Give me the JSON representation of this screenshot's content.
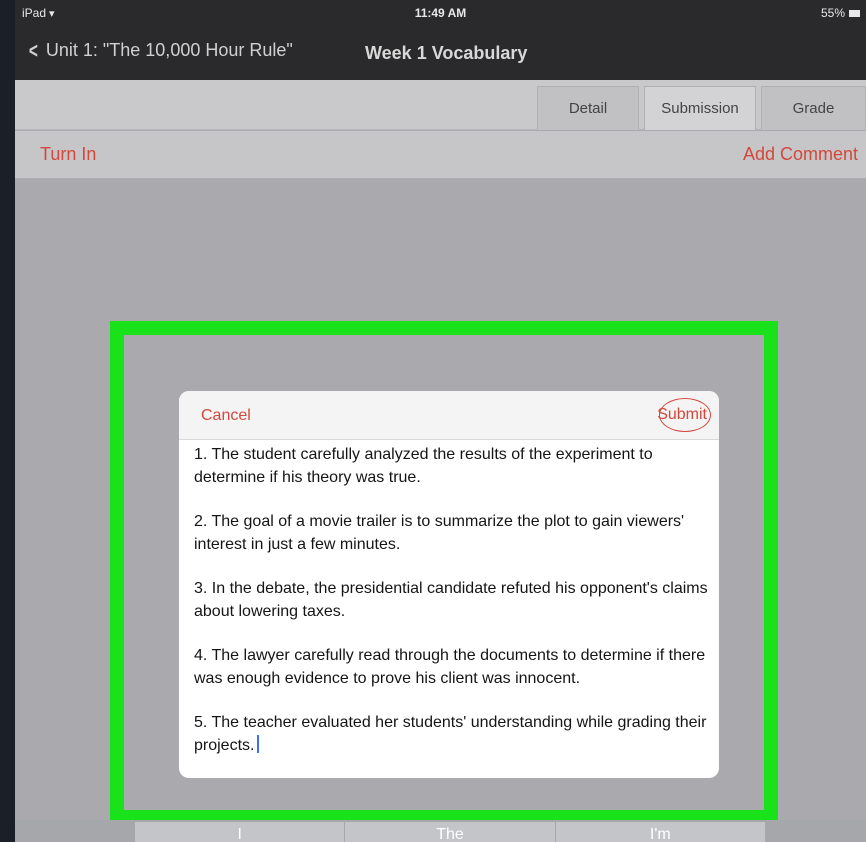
{
  "status_bar": {
    "device": "iPad",
    "time": "11:49 AM",
    "battery": "55%"
  },
  "nav": {
    "back_label": "Unit 1: \"The 10,000 Hour Rule\"",
    "title": "Week 1 Vocabulary"
  },
  "tabs": [
    {
      "label": "Detail"
    },
    {
      "label": "Submission"
    },
    {
      "label": "Grade"
    }
  ],
  "actions": {
    "turn_in": "Turn In",
    "add_comment": "Add Comment"
  },
  "modal": {
    "cancel": "Cancel",
    "submit": "Submit",
    "paragraphs": [
      "1. The student carefully analyzed the results of the experiment to determine if his theory was true.",
      "2. The goal of a movie trailer is to summarize the plot to gain viewers' interest in just a few minutes.",
      "3. In the debate, the presidential candidate refuted his opponent's claims about lowering taxes.",
      "4. The lawyer carefully read through the documents to determine if there was enough evidence to prove his client was innocent.",
      "5. The teacher evaluated her students' understanding while grading their projects."
    ]
  },
  "keyboard_suggestions": [
    "I",
    "The",
    "I'm"
  ],
  "colors": {
    "accent": "#d3483b",
    "highlight": "#19e21b",
    "nav_bg": "#2a2a2c"
  },
  "icons": {
    "back": "chevron-left-icon",
    "wifi": "wifi-icon",
    "battery": "battery-icon"
  }
}
